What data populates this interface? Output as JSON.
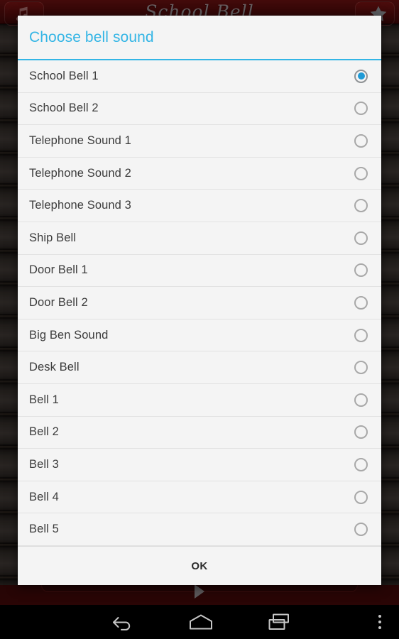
{
  "app": {
    "title": "School Bell",
    "header_left_icon": "music-note-icon",
    "header_right_icon": "star-icon",
    "play_icon": "play-triangle-icon"
  },
  "dialog": {
    "title": "Choose bell sound",
    "accent_color": "#33b5e5",
    "background_color": "#f4f4f4",
    "ok_label": "OK",
    "selected_index": 0,
    "options": [
      {
        "label": "School Bell 1",
        "selected": true
      },
      {
        "label": "School Bell 2",
        "selected": false
      },
      {
        "label": "Telephone Sound 1",
        "selected": false
      },
      {
        "label": "Telephone Sound 2",
        "selected": false
      },
      {
        "label": "Telephone Sound 3",
        "selected": false
      },
      {
        "label": "Ship Bell",
        "selected": false
      },
      {
        "label": "Door Bell 1",
        "selected": false
      },
      {
        "label": "Door Bell 2",
        "selected": false
      },
      {
        "label": "Big Ben Sound",
        "selected": false
      },
      {
        "label": "Desk Bell",
        "selected": false
      },
      {
        "label": "Bell 1",
        "selected": false
      },
      {
        "label": "Bell 2",
        "selected": false
      },
      {
        "label": "Bell 3",
        "selected": false
      },
      {
        "label": "Bell 4",
        "selected": false
      },
      {
        "label": "Bell 5",
        "selected": false
      }
    ]
  },
  "navbar": {
    "back_icon": "back-arrow-icon",
    "home_icon": "home-icon",
    "recents_icon": "recent-apps-icon",
    "menu_icon": "overflow-menu-icon"
  }
}
